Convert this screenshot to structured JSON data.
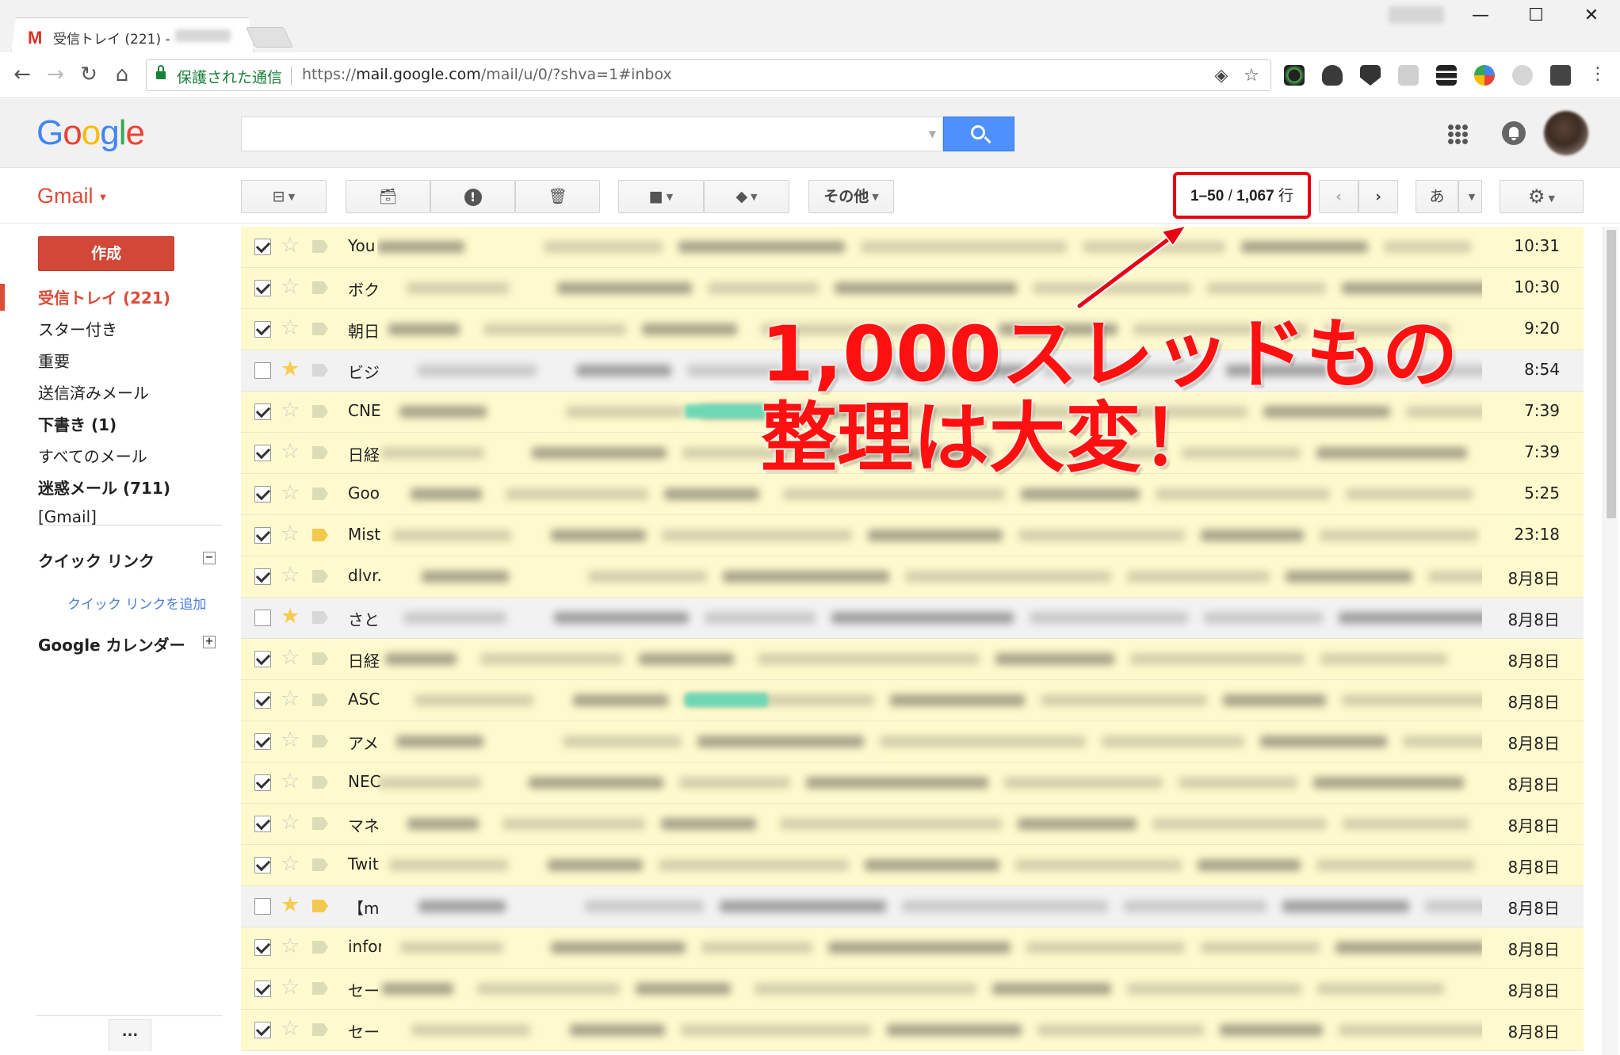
{
  "browser": {
    "tab_title": "受信トレイ (221) -",
    "tab_favicon": "M",
    "secure_label": "保護された通信",
    "url_prefix": "https://",
    "url_host": "mail.google.com",
    "url_path": "/mail/u/0/?shva=1#inbox",
    "window_controls": {
      "minimize": "—",
      "maximize": "☐",
      "close": "✕"
    }
  },
  "header": {
    "logo_letters": [
      "G",
      "o",
      "o",
      "g",
      "l",
      "e"
    ],
    "logo_colors": [
      "#4285f4",
      "#ea4335",
      "#fbbc05",
      "#4285f4",
      "#34a853",
      "#ea4335"
    ],
    "search_placeholder": ""
  },
  "toolbar": {
    "gmail_label": "Gmail",
    "more_label": "その他",
    "counter_range": "1–50",
    "counter_total": "1,067",
    "counter_unit": "行",
    "input_tool_label": "あ"
  },
  "sidebar": {
    "compose_label": "作成",
    "items": [
      {
        "label": "受信トレイ (221)",
        "style": "active"
      },
      {
        "label": "スター付き",
        "style": "normal"
      },
      {
        "label": "重要",
        "style": "normal"
      },
      {
        "label": "送信済みメール",
        "style": "normal"
      },
      {
        "label": "下書き (1)",
        "style": "bold"
      },
      {
        "label": "すべてのメール",
        "style": "normal"
      },
      {
        "label": "迷惑メール (711)",
        "style": "bold"
      },
      {
        "label": "[Gmail]",
        "style": "normal"
      }
    ],
    "quick_links_title": "クイック リンク",
    "quick_links_add": "クイック リンクを追加",
    "calendar_title": "Google カレンダー",
    "more_button": "..."
  },
  "messages": [
    {
      "sender": "You",
      "date": "10:31",
      "checked": true,
      "starred": false,
      "important": false,
      "tag": false
    },
    {
      "sender": "ボク",
      "date": "10:30",
      "checked": true,
      "starred": false,
      "important": false,
      "tag": false
    },
    {
      "sender": "朝日",
      "date": "9:20",
      "checked": true,
      "starred": false,
      "important": false,
      "tag": false
    },
    {
      "sender": "ビジ",
      "date": "8:54",
      "checked": false,
      "starred": true,
      "important": false,
      "tag": false
    },
    {
      "sender": "CNE",
      "date": "7:39",
      "checked": true,
      "starred": false,
      "important": false,
      "tag": true
    },
    {
      "sender": "日経",
      "date": "7:39",
      "checked": true,
      "starred": false,
      "important": false,
      "tag": false
    },
    {
      "sender": "Goo",
      "date": "5:25",
      "checked": true,
      "starred": false,
      "important": false,
      "tag": false
    },
    {
      "sender": "Mist",
      "date": "23:18",
      "checked": true,
      "starred": false,
      "important": true,
      "tag": false
    },
    {
      "sender": "dlvr.",
      "date": "8月8日",
      "checked": true,
      "starred": false,
      "important": false,
      "tag": false
    },
    {
      "sender": "さと",
      "date": "8月8日",
      "checked": false,
      "starred": true,
      "important": false,
      "tag": false
    },
    {
      "sender": "日経",
      "date": "8月8日",
      "checked": true,
      "starred": false,
      "important": false,
      "tag": false
    },
    {
      "sender": "ASC",
      "date": "8月8日",
      "checked": true,
      "starred": false,
      "important": false,
      "tag": true
    },
    {
      "sender": "アメ",
      "date": "8月8日",
      "checked": true,
      "starred": false,
      "important": false,
      "tag": false
    },
    {
      "sender": "NEC",
      "date": "8月8日",
      "checked": true,
      "starred": false,
      "important": false,
      "tag": false
    },
    {
      "sender": "マネ",
      "date": "8月8日",
      "checked": true,
      "starred": false,
      "important": false,
      "tag": false
    },
    {
      "sender": "Twit",
      "date": "8月8日",
      "checked": true,
      "starred": false,
      "important": false,
      "tag": false
    },
    {
      "sender": "【m",
      "date": "8月8日",
      "checked": false,
      "starred": true,
      "important": true,
      "tag": false
    },
    {
      "sender": "infor",
      "date": "8月8日",
      "checked": true,
      "starred": false,
      "important": false,
      "tag": false
    },
    {
      "sender": "セー",
      "date": "8月8日",
      "checked": true,
      "starred": false,
      "important": false,
      "tag": false
    },
    {
      "sender": "セー",
      "date": "8月8日",
      "checked": true,
      "starred": false,
      "important": false,
      "tag": false
    }
  ],
  "annotation": {
    "line1": "1,000スレッドもの",
    "line2": "整理は大変！",
    "color": "#ff1010"
  },
  "icons": {
    "back": "back-arrow-icon",
    "forward": "forward-arrow-icon",
    "reload": "reload-icon",
    "home": "home-icon",
    "archive": "archive-icon",
    "spam": "report-spam-icon",
    "delete": "trash-icon",
    "folder": "move-to-folder-icon",
    "label": "label-tag-icon",
    "settings": "gear-icon"
  }
}
